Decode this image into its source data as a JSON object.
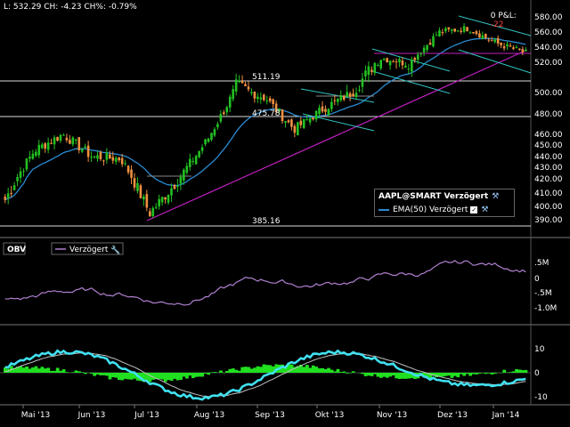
{
  "header": {
    "quote": "L: 532.29 CH: -4.23 CH%: -0.79%",
    "pnl_label": "0 P&L:",
    "pnl_value": "-22"
  },
  "main_panel": {
    "price_ticks": [
      "580.00",
      "560.00",
      "540.00",
      "520.00",
      "500.00",
      "480.00",
      "460.00",
      "450.00",
      "440.00",
      "430.00",
      "420.00",
      "410.00",
      "400.00",
      "390.00"
    ],
    "annotations": {
      "high_label": "511.19",
      "mid_label": "475.78",
      "low_label": "385.16"
    },
    "legend": {
      "title": "AAPL@SMART Verzögert",
      "ema_label": "EMA(50) Verzögert"
    }
  },
  "obv_panel": {
    "title": "OBV",
    "series_label": "Verzögert",
    "ticks": [
      ".5M",
      "0",
      "-.5M",
      "-1.0M"
    ]
  },
  "osc_panel": {
    "ticks": [
      "10",
      "0",
      "-10"
    ]
  },
  "x_axis": {
    "labels": [
      "Mai '13",
      "Jun '13",
      "Jul '13",
      "Aug '13",
      "Sep '13",
      "Okt '13",
      "Nov '13",
      "Dez '13",
      "Jan '14"
    ]
  },
  "colors": {
    "up": "#22c022",
    "down": "#f09040",
    "ema": "#2a8ad0",
    "trend_magenta": "#c020c0",
    "channel_cyan": "#30c0c0",
    "obv": "#b080d0",
    "osc_fast": "#40e0f0",
    "osc_slow": "#c0c0c0",
    "histogram": "#20e020",
    "pnl_red": "#ff4040"
  },
  "chart_data": [
    {
      "type": "candlestick",
      "title": "AAPL@SMART Verzögert",
      "ylim": [
        385,
        585
      ],
      "x": [
        "Mai '13",
        "Jun '13",
        "Jul '13",
        "Aug '13",
        "Sep '13",
        "Okt '13",
        "Nov '13",
        "Dez '13",
        "Jan '14"
      ],
      "close_path": [
        {
          "x": "Apr '13",
          "y": 405
        },
        {
          "x": "Mai '13",
          "y": 445
        },
        {
          "x": "Mai '13",
          "y": 460
        },
        {
          "x": "Jun '13",
          "y": 440
        },
        {
          "x": "Jun '13",
          "y": 438
        },
        {
          "x": "Jul '13",
          "y": 395
        },
        {
          "x": "Jul '13",
          "y": 420
        },
        {
          "x": "Aug '13",
          "y": 455
        },
        {
          "x": "Aug '13",
          "y": 505
        },
        {
          "x": "Sep '13",
          "y": 495
        },
        {
          "x": "Sep '13",
          "y": 465
        },
        {
          "x": "Okt '13",
          "y": 485
        },
        {
          "x": "Okt '13",
          "y": 500
        },
        {
          "x": "Nov '13",
          "y": 525
        },
        {
          "x": "Nov '13",
          "y": 520
        },
        {
          "x": "Dez '13",
          "y": 560
        },
        {
          "x": "Dez '13",
          "y": 565
        },
        {
          "x": "Jan '14",
          "y": 545
        },
        {
          "x": "Jan '14",
          "y": 532.29
        }
      ],
      "series": [
        {
          "name": "EMA(50) Verzögert"
        }
      ]
    },
    {
      "type": "line",
      "title": "OBV",
      "series": [
        {
          "name": "Verzögert"
        }
      ],
      "ylim": [
        -1.2,
        0.8
      ]
    },
    {
      "type": "line",
      "ylim": [
        -12,
        14
      ],
      "series": []
    }
  ]
}
